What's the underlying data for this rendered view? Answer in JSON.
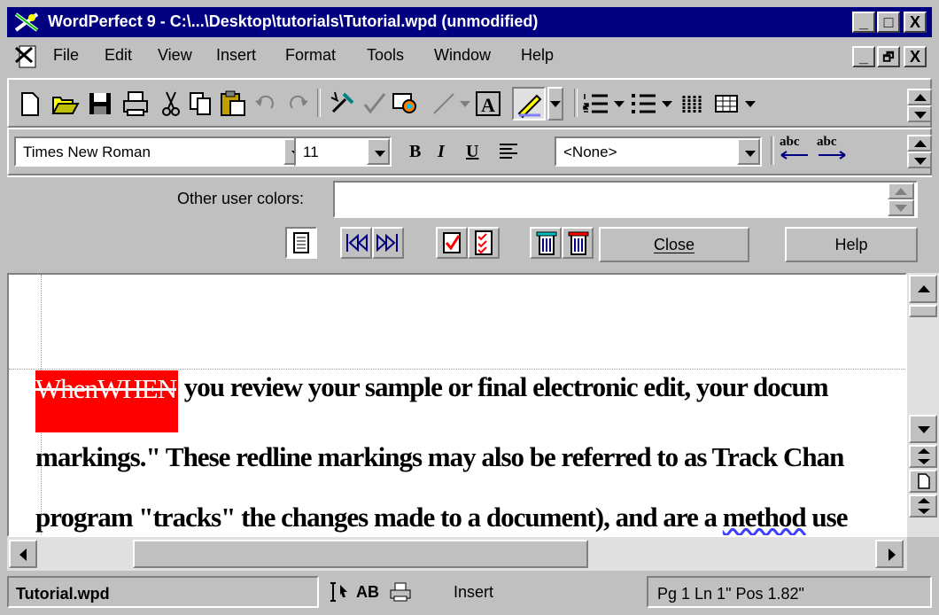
{
  "window": {
    "title": "WordPerfect 9 - C:\\...\\Desktop\\tutorials\\Tutorial.wpd (unmodified)",
    "minimize_glyph": "_",
    "maximize_glyph": "□",
    "close_glyph": "X",
    "restore_glyph": "🗗"
  },
  "menu": {
    "items": [
      {
        "label": "File",
        "mnemonic": "F"
      },
      {
        "label": "Edit",
        "mnemonic": "E"
      },
      {
        "label": "View",
        "mnemonic": "V"
      },
      {
        "label": "Insert",
        "mnemonic": "I"
      },
      {
        "label": "Format",
        "mnemonic": "r"
      },
      {
        "label": "Tools",
        "mnemonic": "T"
      },
      {
        "label": "Window",
        "mnemonic": "W"
      },
      {
        "label": "Help",
        "mnemonic": "H"
      }
    ]
  },
  "property_bar": {
    "font_name": "Times New Roman",
    "font_size": "11",
    "bold_label": "B",
    "italic_label": "I",
    "underline_label": "U",
    "style_value": "<None>",
    "abc_left": "abc",
    "abc_right": "abc"
  },
  "review_bar": {
    "other_colors_label": "Other user colors:",
    "other_colors_mnemonic": "O",
    "close_label": "Close",
    "close_mnemonic": "C",
    "help_label": "Help",
    "help_mnemonic": "H"
  },
  "document": {
    "line1_deleted": "When",
    "line1_inserted": "WHEN",
    "line1_rest": " you review your sample or final electronic edit, your docum",
    "line2": "markings.\" These redline markings may also be referred to as Track Chan",
    "line3_start": "program \"tracks\" the changes made to a document), and are a ",
    "line3_squig": "method",
    "line3_end": " use"
  },
  "status": {
    "filename": "Tutorial.wpd",
    "mode_ab": "AB",
    "insert_label": "Insert",
    "position": "Pg 1 Ln 1\" Pos 1.82\""
  },
  "colors": {
    "title_bar": "#000080",
    "redline_fill": "#ff0000",
    "chrome": "#c0c0c0"
  },
  "icons": [
    "app-icon",
    "doc-icon",
    "new-doc-icon",
    "open-icon",
    "save-icon",
    "print-icon",
    "cut-icon",
    "copy-icon",
    "paste-icon",
    "undo-icon",
    "redo-icon",
    "quickformat-icon",
    "spell-icon",
    "highlight-icon",
    "line-icon",
    "textbox-icon",
    "pen-icon",
    "numbering-icon",
    "bullets-icon",
    "columns-icon",
    "table-icon",
    "first-rev-icon",
    "prev-rev-icon",
    "next-rev-icon",
    "accept-icon",
    "accept-all-icon",
    "reject-icon",
    "reject-all-icon",
    "insertion-point-icon",
    "print-status-icon"
  ]
}
